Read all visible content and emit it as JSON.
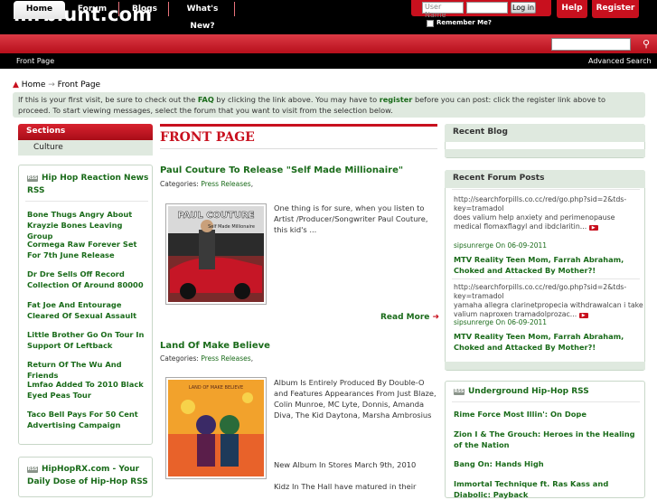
{
  "site": {
    "logo": "mrblunt.com"
  },
  "login": {
    "username_placeholder": "User Name",
    "login_label": "Log in",
    "remember_label": "Remember Me?"
  },
  "header_buttons": {
    "help": "Help",
    "register": "Register"
  },
  "nav": {
    "tabs": [
      {
        "label": "Home",
        "active": true
      },
      {
        "label": "Forum"
      },
      {
        "label": "Blogs"
      },
      {
        "label": "What's New?"
      }
    ]
  },
  "subnav": {
    "front_page": "Front Page",
    "advanced_search": "Advanced Search"
  },
  "breadcrumb": {
    "home": "Home",
    "current": "Front Page"
  },
  "notice": {
    "part1": "If this is your first visit, be sure to check out the ",
    "faq": "FAQ",
    "part2": " by clicking the link above. You may have to ",
    "register": "register",
    "part3": " before you can post: click the register link above to proceed. To start viewing messages, select the forum that you want to visit from the selection below."
  },
  "sections": {
    "title": "Sections",
    "items": [
      "Culture"
    ]
  },
  "feed_left": {
    "title_line1": "Hip Hop Reaction News",
    "title_line2": "RSS",
    "rss_label": "RSS",
    "items": [
      "Bone Thugs Angry About Krayzie Bones Leaving Group",
      "Cormega Raw Forever Set For 7th June Release",
      "Dr Dre Sells Off Record Collection Of Around 80000",
      "Fat Joe And Entourage Cleared Of Sexual Assault",
      "Little Brother Go On Tour In Support Of Leftback",
      "Return Of The Wu And Friends",
      "Lmfao Added To 2010 Black Eyed Peas Tour",
      "Taco Bell Pays For 50 Cent Advertising Campaign"
    ]
  },
  "feed_left2": {
    "title_line1": "HipHopRX.com - Your",
    "title_line2": "Daily Dose of Hip-Hop  RSS",
    "rss_label": "RSS"
  },
  "center": {
    "title": "FRONT PAGE",
    "articles": [
      {
        "title": "Paul Couture To Release \"Self Made Millionaire\"",
        "category_prefix": "Categories: ",
        "category": "Press Releases",
        "category_suffix": ",",
        "excerpt": "One thing is for sure, when you listen to Artist /Producer/Songwriter Paul Couture, this kid's ...",
        "image_text_1": "PAUL COUTURE",
        "image_text_2": "Self Made Millionaire",
        "read_more": "Read More"
      },
      {
        "title": "Land Of Make Believe",
        "category_prefix": "Categories: ",
        "category": "Press Releases",
        "category_suffix": ",",
        "excerpt_1": "Album Is Entirely Produced By Double-O and Features Appearances From Just Blaze, Colin Munroe, MC Lyte, Donnis, Amanda Diva, The Kid Daytona, Marsha Ambrosius",
        "excerpt_2": "New Album In Stores March 9th, 2010",
        "excerpt_3": "Kidz In The Hall have matured in their",
        "image_text": "LAND OF MAKE BELIEVE"
      }
    ]
  },
  "recent_blog": {
    "title": "Recent Blog"
  },
  "recent_forum": {
    "title": "Recent Forum Posts",
    "posts": [
      {
        "url": "http://searchforpills.co.cc/red/go.php?sid=2&tds-key=tramadol",
        "text": "does valium help anxiety and perimenopause medical flomaxflagyl and ibdclaritin...",
        "user": "sipsunrerge",
        "date": " On 06-09-2011",
        "thread": "MTV Reality Teen Mom, Farrah Abraham, Choked and Attacked By Mother?!"
      },
      {
        "url": "http://searchforpills.co.cc/red/go.php?sid=2&tds-key=tramadol",
        "text": "yamaha allegra clarinetpropecia withdrawalcan i take valium naproxen tramadolprozac...",
        "user": "sipsunrerge",
        "date": " On 06-09-2011",
        "thread": "MTV Reality Teen Mom, Farrah Abraham, Choked and Attacked By Mother?!"
      }
    ]
  },
  "feed_right": {
    "title": "Underground Hip-Hop  RSS",
    "rss_label": "RSS",
    "items": [
      "Rime Force Most Illin': On Dope",
      "Zion I & The Grouch: Heroes in the Healing of the Nation",
      "Bang On: Hands High",
      "Immortal Technique ft. Ras Kass and Diabolic: Payback"
    ]
  }
}
